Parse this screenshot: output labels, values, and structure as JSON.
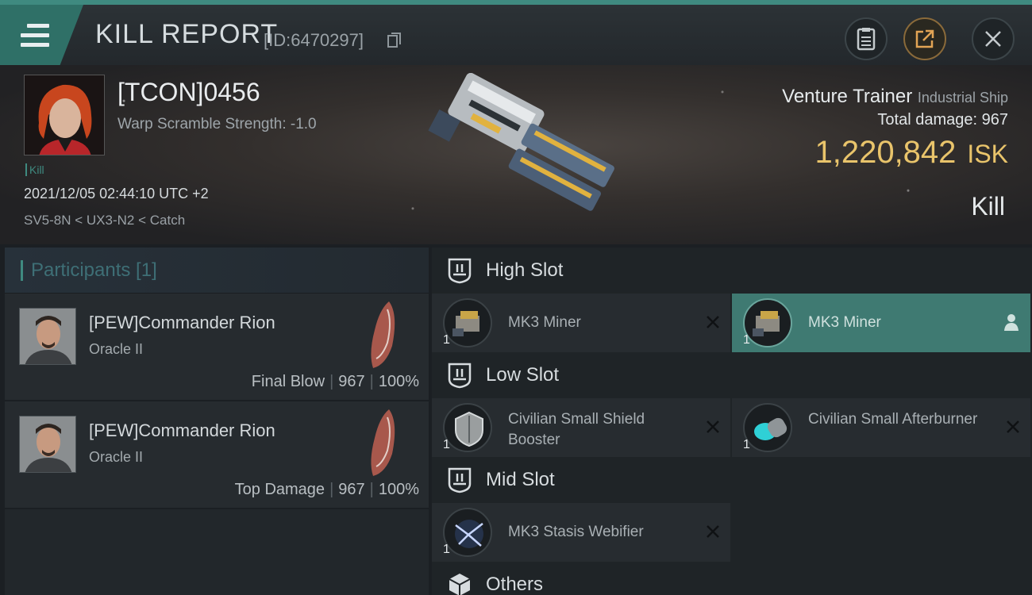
{
  "header": {
    "title": "KILL REPORT",
    "id_text": "[ID:6470297]"
  },
  "victim": {
    "name": "[TCON]0456",
    "warp_scramble": "Warp Scramble Strength: -1.0",
    "tag": "Kill",
    "timestamp": "2021/12/05 02:44:10 UTC +2",
    "location": "SV5-8N < UX3-N2 < Catch",
    "ship_name": "Venture Trainer",
    "ship_class": "Industrial Ship",
    "total_damage_label": "Total damage:",
    "total_damage": "967",
    "isk_value": "1,220,842",
    "isk_unit": "ISK",
    "result": "Kill"
  },
  "participants": {
    "title": "Participants [1]",
    "items": [
      {
        "name": "[PEW]Commander Rion",
        "ship": "Oracle II",
        "role": "Final Blow",
        "damage": "967",
        "percent": "100%"
      },
      {
        "name": "[PEW]Commander Rion",
        "ship": "Oracle II",
        "role": "Top Damage",
        "damage": "967",
        "percent": "100%"
      }
    ]
  },
  "fitting": {
    "high_slot_label": "High Slot",
    "low_slot_label": "Low Slot",
    "mid_slot_label": "Mid Slot",
    "others_label": "Others",
    "high": [
      {
        "name": "MK3 Miner",
        "qty": "1"
      },
      {
        "name": "MK3 Miner",
        "qty": "1"
      }
    ],
    "low": [
      {
        "name": "Civilian Small Shield Booster",
        "qty": "1"
      },
      {
        "name": "Civilian Small Afterburner",
        "qty": "1"
      }
    ],
    "mid": [
      {
        "name": "MK3 Stasis Webifier",
        "qty": "1"
      }
    ]
  },
  "colors": {
    "accent": "#3f8a80",
    "isk_gold": "#e9c46b",
    "active_slot": "#3f7a72"
  }
}
